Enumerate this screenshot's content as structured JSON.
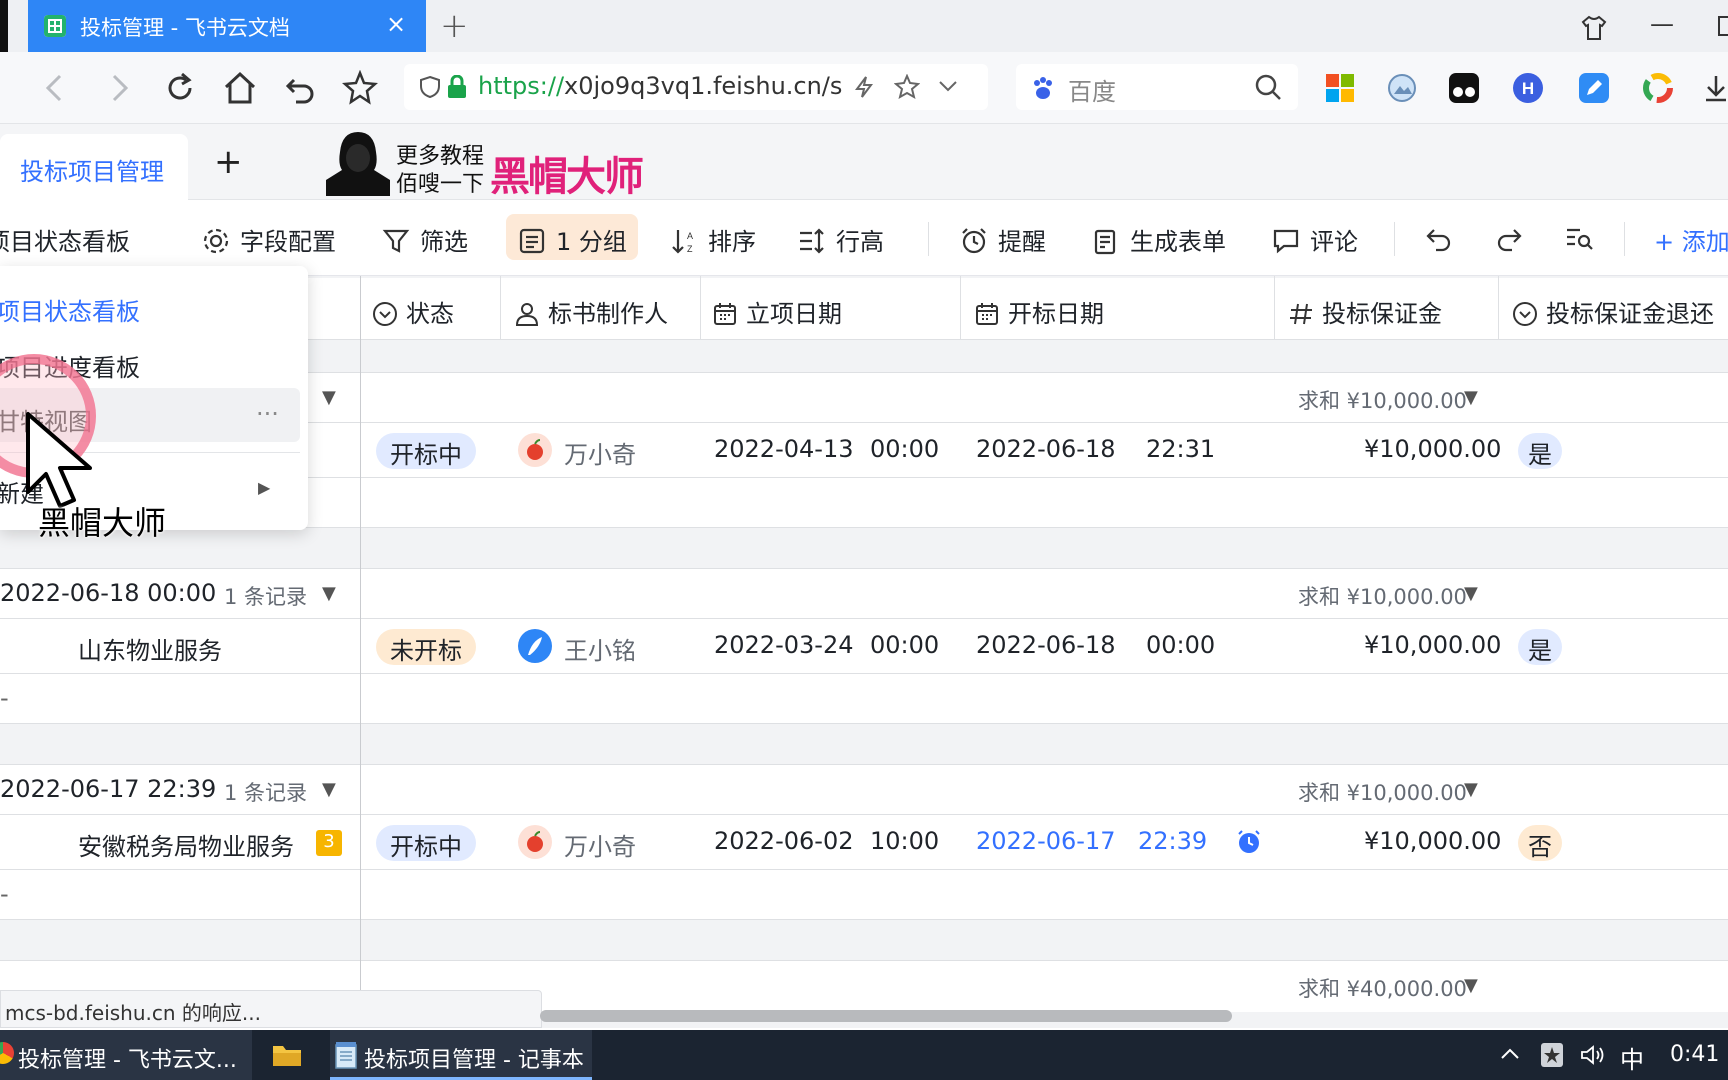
{
  "browser": {
    "tab_title": "投标管理 - 飞书云文档",
    "tab_close": "×",
    "new_tab": "+",
    "url_scheme": "https://",
    "url_rest": "x0jo9q3vq1.feishu.cn/s",
    "search_placeholder": "百度",
    "window_min": "—"
  },
  "doc": {
    "tab_label": "投标项目管理",
    "add_tab": "+",
    "watermark_line1": "更多教程",
    "watermark_line2": "佰嗖一下",
    "watermark_brand": "黑帽大师"
  },
  "toolbar": {
    "view_name": "项目状态看板",
    "fields": "字段配置",
    "filter": "筛选",
    "group": "1 分组",
    "sort": "排序",
    "row_height": "行高",
    "reminder": "提醒",
    "form": "生成表单",
    "comment": "评论",
    "add": "+ 添加"
  },
  "view_menu": {
    "items": [
      "项目状态看板",
      "项目进度看板",
      "甘特视图",
      "新建"
    ],
    "more": "···",
    "submenu_arrow": "▶"
  },
  "cursor_watermark": "黑帽大师",
  "columns": {
    "status": "状态",
    "maker": "标书制作人",
    "project_date": "立项日期",
    "bid_date": "开标日期",
    "deposit": "投标保证金",
    "deposit_return": "投标保证金退还"
  },
  "groups": [
    {
      "title": "",
      "count": "",
      "sum": "求和 ¥10,000.00",
      "row": {
        "name": "",
        "badge": "",
        "status": "开标中",
        "maker": "万小奇",
        "project_date": "2022-04-13",
        "project_time": "00:00",
        "bid_date": "2022-06-18",
        "bid_time": "22:31",
        "deposit": "¥10,000.00",
        "returned": "是"
      }
    },
    {
      "title": "2022-06-18 00:00",
      "count": "1 条记录",
      "sum": "求和 ¥10,000.00",
      "row": {
        "name": "山东物业服务",
        "badge": "",
        "status": "未开标",
        "maker": "王小铭",
        "project_date": "2022-03-24",
        "project_time": "00:00",
        "bid_date": "2022-06-18",
        "bid_time": "00:00",
        "deposit": "¥10,000.00",
        "returned": "是"
      }
    },
    {
      "title": "2022-06-17 22:39",
      "count": "1 条记录",
      "sum": "求和 ¥10,000.00",
      "row": {
        "name": "安徽税务局物业服务",
        "badge": "3",
        "status": "开标中",
        "maker": "万小奇",
        "project_date": "2022-06-02",
        "project_time": "10:00",
        "bid_date": "2022-06-17",
        "bid_time": "22:39",
        "deposit": "¥10,000.00",
        "returned": "否"
      }
    },
    {
      "title": "",
      "count": "",
      "sum": "求和 ¥40,000.00"
    }
  ],
  "add_row_mark": "-",
  "status_bar": "mcs-bd.feishu.cn 的响应...",
  "taskbar": {
    "task1": "投标管理 - 飞书云文...",
    "task2": "投标项目管理 - 记事本",
    "ime": "中",
    "clock": "0:41"
  },
  "colors": {
    "accent": "#3370ff",
    "tab_blue": "#2e86f6",
    "group_highlight": "#fde9d7",
    "pill_blue": "#e1eaff",
    "pill_orange": "#feead2",
    "watermark_pink": "#e0217a"
  }
}
